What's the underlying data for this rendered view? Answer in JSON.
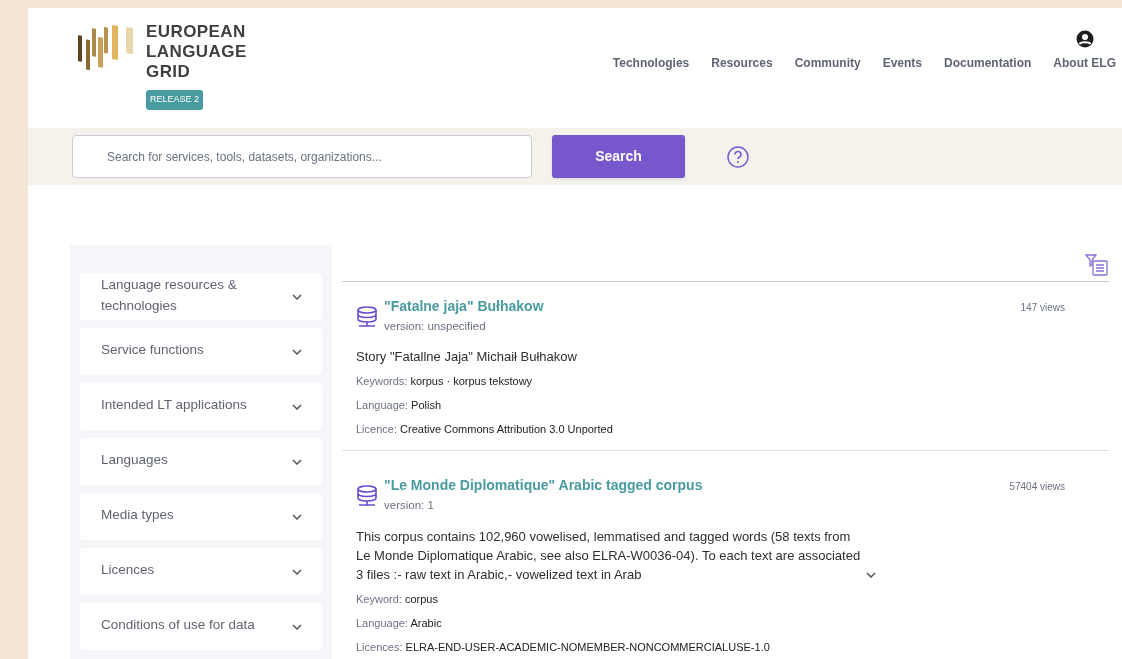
{
  "logo": {
    "title_lines": [
      "EUROPEAN",
      "LANGUAGE",
      "GRID"
    ],
    "badge": "RELEASE 2"
  },
  "nav": [
    "Technologies",
    "Resources",
    "Community",
    "Events",
    "Documentation",
    "About ELG"
  ],
  "search": {
    "placeholder": "Search for services, tools, datasets, organizations...",
    "button": "Search"
  },
  "filters": [
    {
      "label": "Language resources & technologies",
      "expanded": false
    },
    {
      "label": "Service functions",
      "expanded": false
    },
    {
      "label": "Intended LT applications",
      "expanded": false
    },
    {
      "label": "Languages",
      "expanded": false
    },
    {
      "label": "Media types",
      "expanded": false
    },
    {
      "label": "Licences",
      "expanded": false
    },
    {
      "label": "Conditions of use for data",
      "expanded": false
    }
  ],
  "results": [
    {
      "title": "\"Fatalne jaja\" Bułhakow",
      "version": "version: unspecified",
      "views": "147 views",
      "description": "Story \"Fatallne Jaja\" Michaił Bułhakow",
      "meta": [
        {
          "label": "Keywords:",
          "value": "korpus · korpus tekstowy"
        },
        {
          "label": "Language:",
          "value": "Polish"
        },
        {
          "label": "Licence:",
          "value": "Creative Commons Attribution 3.0 Unported"
        }
      ]
    },
    {
      "title": "\"Le Monde Diplomatique\" Arabic tagged corpus",
      "version": "version: 1",
      "views": "57404 views",
      "description": "This corpus contains 102,960 vowelised, lemmatised and tagged words (58 texts from Le Monde Diplomatique Arabic, see also ELRA-W0036-04). To each text are associated 3 files :- raw text in Arabic,- vowelized text in Arab",
      "truncated": true,
      "meta": [
        {
          "label": "Keyword:",
          "value": "corpus"
        },
        {
          "label": "Language:",
          "value": "Arabic"
        },
        {
          "label": "Licences:",
          "value": "ELRA-END-USER-ACADEMIC-NOMEMBER-NONCOMMERCIALUSE-1.0"
        }
      ]
    }
  ]
}
